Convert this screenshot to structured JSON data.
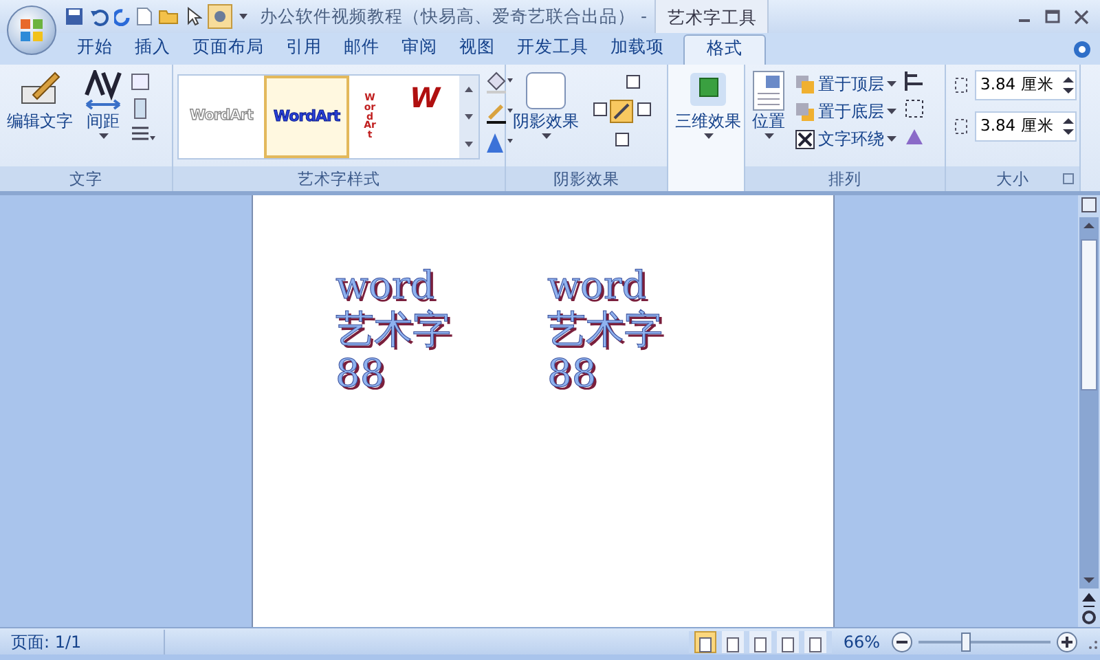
{
  "window": {
    "title": "办公软件视频教程（快易高、爱奇艺联合出品） -",
    "context_group": "艺术字工具"
  },
  "tabs": [
    {
      "label": "开始",
      "selected": false
    },
    {
      "label": "插入",
      "selected": false
    },
    {
      "label": "页面布局",
      "selected": false
    },
    {
      "label": "引用",
      "selected": false
    },
    {
      "label": "邮件",
      "selected": false
    },
    {
      "label": "审阅",
      "selected": false
    },
    {
      "label": "视图",
      "selected": false
    },
    {
      "label": "开发工具",
      "selected": false
    },
    {
      "label": "加载项",
      "selected": false
    },
    {
      "label": "格式",
      "selected": true
    }
  ],
  "ribbon": {
    "text_group": {
      "label": "文字",
      "edit": "编辑文字",
      "spacing": "间距"
    },
    "styles_group": {
      "label": "艺术字样式",
      "gallery": [
        {
          "text": "WordArt",
          "kind": "outline",
          "selected": false
        },
        {
          "text": "WordArt",
          "kind": "blue",
          "selected": true
        },
        {
          "text": "WordArt",
          "kind": "vertical",
          "selected": false
        },
        {
          "text": "W",
          "kind": "red",
          "selected": false
        }
      ]
    },
    "shadow_group": {
      "label": "阴影效果",
      "button": "阴影效果"
    },
    "threed_group": {
      "button": "三维效果"
    },
    "arrange_group": {
      "label": "排列",
      "position": "位置",
      "items": [
        "置于顶层",
        "置于底层",
        "文字环绕"
      ]
    },
    "size_group": {
      "label": "大小",
      "height": "3.84 厘米",
      "width": "3.84 厘米"
    }
  },
  "document": {
    "wordart": [
      {
        "lines": [
          "word",
          "艺术字",
          "88"
        ]
      },
      {
        "lines": [
          "word",
          "艺术字",
          "88"
        ]
      }
    ]
  },
  "status_bar": {
    "page": "页面: 1/1",
    "views": [
      {
        "selected": true
      },
      {
        "selected": false
      },
      {
        "selected": false
      },
      {
        "selected": false
      },
      {
        "selected": false
      }
    ],
    "zoom": "66%",
    "zoom_slider": {
      "level": 0.35
    }
  }
}
